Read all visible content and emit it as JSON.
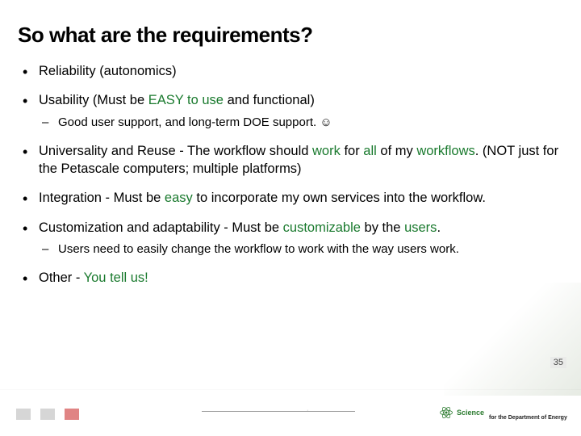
{
  "title": "So what are the requirements?",
  "items": {
    "reliability": {
      "text": "Reliability (autonomics)"
    },
    "usability": {
      "pre": "Usability (Must be ",
      "easy": "EASY to use",
      "post": " and functional)",
      "sub": "Good user support, and long-term DOE support. ☺"
    },
    "universality": {
      "pre": "Universality and Reuse - The workflow should ",
      "work": "work",
      "mid": " for ",
      "all": "all",
      "mid2": " of my ",
      "workflows": "workflows",
      "post": ". (NOT just for the Petascale computers; multiple platforms)"
    },
    "integration": {
      "pre": "Integration - Must be ",
      "easy": "easy",
      "post": " to incorporate my own services into the workflow."
    },
    "custom": {
      "pre": "Customization and adaptability - Must be ",
      "c": "customizable",
      "mid": " by the ",
      "u": "users",
      "post": ".",
      "sub": "Users need to easily change the workflow to work with the way users work."
    },
    "other": {
      "pre": "Other - ",
      "tell": "You tell us!"
    }
  },
  "page": "35",
  "footer": {
    "science": "Science",
    "right": "for the Department of Energy"
  }
}
